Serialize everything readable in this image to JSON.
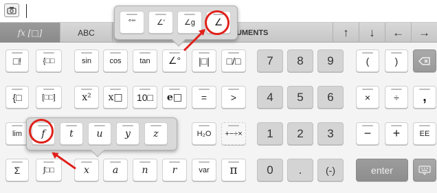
{
  "entry": {
    "value": ""
  },
  "tabs": {
    "fx": "fx [□]",
    "abc": "ABC",
    "instruments": "RUMENTS"
  },
  "nav": {
    "up": "↑",
    "down": "↓",
    "left": "←",
    "right": "→"
  },
  "rows": {
    "r1": {
      "fact": "□!",
      "piece": "{□□",
      "sin": "sin",
      "cos": "cos",
      "tan": "tan",
      "angle_deg": "∠°",
      "abs": "|□|",
      "frac": "□/□"
    },
    "r2": {
      "system": "{□",
      "matrix": "[□□]",
      "sq": "x²",
      "pow": "x□",
      "ten": "10□",
      "exp": "e□",
      "eq": "=",
      "gt": ">"
    },
    "r3": {
      "lim": "lim",
      "h2o": "H₂O",
      "pm": "+−÷×"
    },
    "r4": {
      "sum": "Σ",
      "integral": "∫□□",
      "x": "x",
      "a": "a",
      "n": "n",
      "r": "r",
      "var": "var",
      "pi": "π"
    }
  },
  "numpad": {
    "seven": "7",
    "eight": "8",
    "nine": "9",
    "four": "4",
    "five": "5",
    "six": "6",
    "one": "1",
    "two": "2",
    "three": "3",
    "zero": "0",
    "dot": ".",
    "neg": "(-)"
  },
  "ops": {
    "lparen": "(",
    "rparen": ")",
    "times": "×",
    "divide": "÷",
    "comma": ",",
    "minus": "−",
    "plus": "+",
    "ee": "EE",
    "enter": "enter"
  },
  "angle_popup": {
    "dms": "°'\"",
    "minute": "∠'",
    "grad": "∠g",
    "angle": "∠"
  },
  "var_popup": {
    "f": "f",
    "t": "t",
    "u": "u",
    "y": "y",
    "z": "z"
  },
  "colors": {
    "highlight": "#e0201a",
    "num_key": "#d4d4d4",
    "tab_bar": "#cfcfcf"
  }
}
